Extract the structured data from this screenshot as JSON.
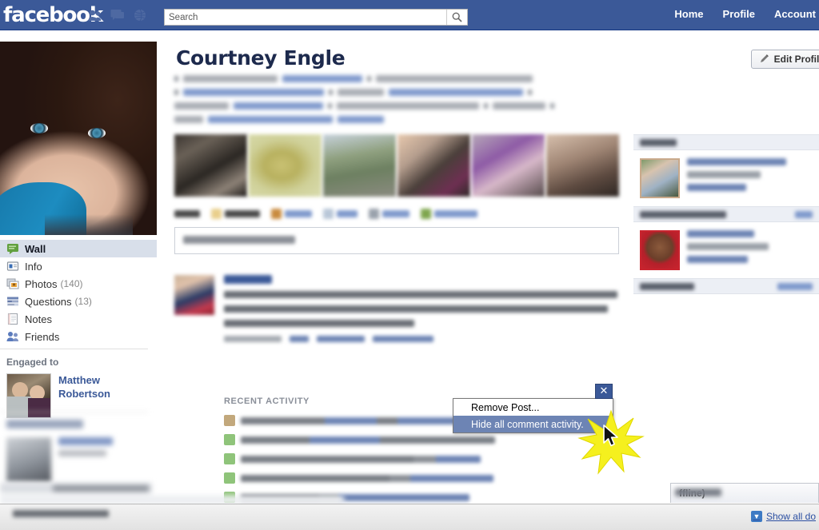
{
  "topbar": {
    "logo": "facebook",
    "icons": [
      "friend-requests-icon",
      "messages-icon",
      "notifications-globe-icon"
    ],
    "search_placeholder": "Search",
    "search_value": "",
    "search_button_icon": "search-icon",
    "nav": [
      {
        "label": "Home"
      },
      {
        "label": "Profile"
      },
      {
        "label": "Account"
      }
    ],
    "bg_color": "#3b5998"
  },
  "sidebar": {
    "profile_photo_alt": "profile-photo",
    "items": [
      {
        "label": "Wall",
        "count": "",
        "icon": "wall-icon",
        "active": true
      },
      {
        "label": "Info",
        "count": "",
        "icon": "info-icon",
        "active": false
      },
      {
        "label": "Photos",
        "count": "(140)",
        "icon": "photos-icon",
        "active": false
      },
      {
        "label": "Questions",
        "count": "(13)",
        "icon": "questions-icon",
        "active": false
      },
      {
        "label": "Notes",
        "count": "",
        "icon": "notes-icon",
        "active": false
      },
      {
        "label": "Friends",
        "count": "",
        "icon": "friends-icon",
        "active": false
      }
    ],
    "engaged": {
      "title": "Engaged to",
      "name": "Matthew Robertson"
    }
  },
  "profile": {
    "name": "Courtney Engle",
    "edit_button_label": "Edit Profile",
    "edit_button_icon": "pencil-icon"
  },
  "main": {
    "recent_activity_title": "RECENT ACTIVITY"
  },
  "context_menu": {
    "close_icon": "close-icon",
    "items": [
      {
        "label": "Remove Post...",
        "selected": false
      },
      {
        "label": "Hide all comment activity.",
        "selected": true
      }
    ],
    "highlight_color": "#6d84b4"
  },
  "cursor": {
    "icon": "mouse-pointer-icon",
    "highlight": "yellow-starburst"
  },
  "chatbar": {
    "label": "ffline)",
    "full_label_hint": "Chat (Offline)"
  },
  "downloadbar": {
    "show_all_label": "Show all do",
    "show_all_icon": "download-icon"
  }
}
